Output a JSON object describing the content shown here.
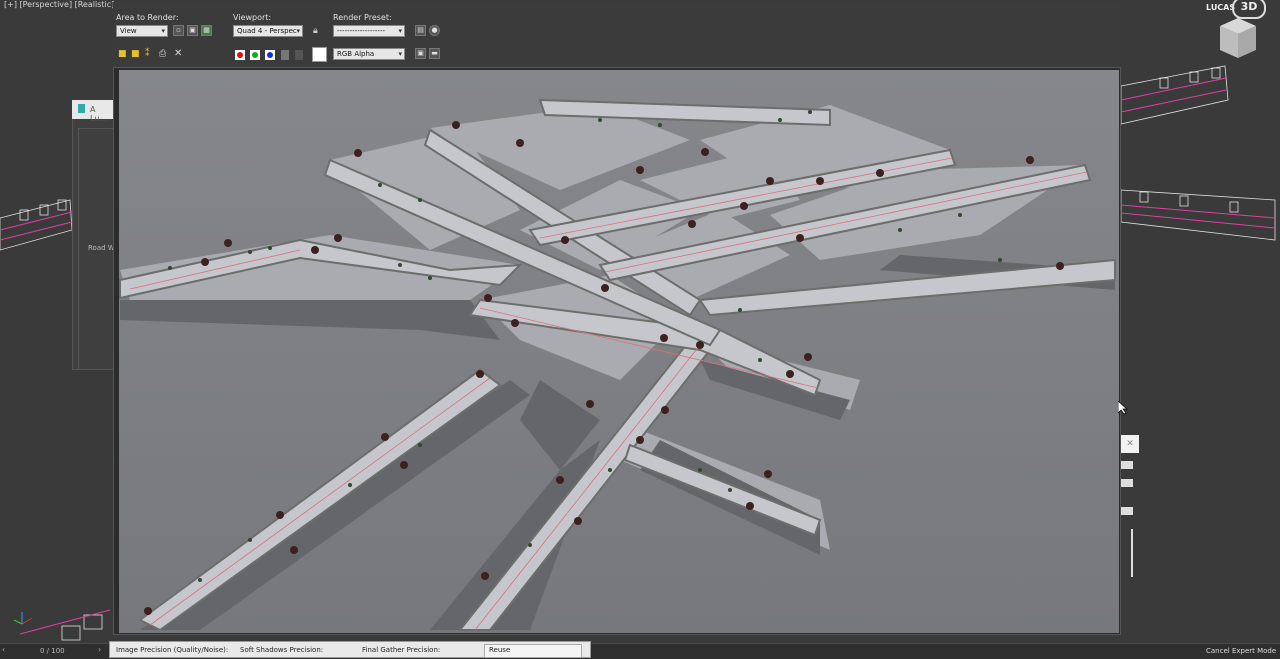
{
  "viewport": {
    "label": "[+] [Perspective] [Realistic]",
    "brand_text": "LUCAS",
    "brand_badge": "3D",
    "frame_counter": "0 / 100",
    "cancel_expert_mode": "Cancel Expert Mode"
  },
  "left_dialog": {
    "title": "A Lu...",
    "side_label": "Road W"
  },
  "render_toolbar": {
    "area_to_render_label": "Area to Render:",
    "area_to_render_value": "View",
    "viewport_label": "Viewport:",
    "viewport_value": "Quad 4 - Perspec",
    "render_preset_label": "Render Preset:",
    "render_preset_value": "-------------------",
    "channel_value": "RGB Alpha",
    "colors": {
      "red": "#e01010",
      "green": "#10b010",
      "blue": "#1030e0"
    }
  },
  "render_settings": {
    "image_precision_label": "Image Precision (Quality/Noise):",
    "soft_shadows_label": "Soft Shadows Precision:",
    "final_gather_label": "Final Gather Precision:",
    "reuse_label": "Reuse"
  },
  "icons": [
    "save-icon",
    "copy-icon",
    "clone-icon",
    "print-icon",
    "clear-icon",
    "lock-icon",
    "render-icon",
    "close-icon",
    "viewcube-icon"
  ]
}
